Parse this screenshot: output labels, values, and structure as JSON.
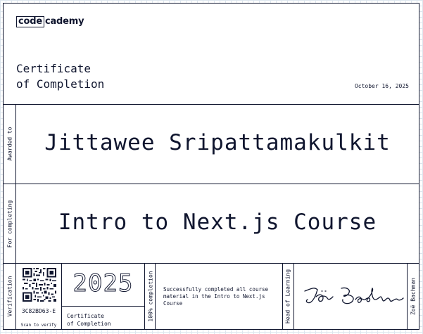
{
  "logo": {
    "part1": "code",
    "part2": "cademy"
  },
  "certificate": {
    "title": "Certificate\nof Completion",
    "date": "October 16, 2025",
    "awarded_label": "Awarded to",
    "recipient": "Jittawee Sripattamakulkit",
    "for_label": "For completing",
    "course": "Intro to Next.js Course"
  },
  "footer": {
    "verification_label": "Verification",
    "cert_id": "3C82BD63-E",
    "scan_text": "Scan to verify",
    "year": "2025",
    "cert_type": "Certificate\nof Completion",
    "completion_label": "100% completion",
    "description": "Successfully completed all course material in the Intro to Next.js Course",
    "signer_role": "Head of Learning",
    "signer_name": "Zoë Bachman",
    "signature_text": "Zoë Bachman"
  },
  "colors": {
    "ink": "#10162f",
    "grid": "#dde6ee"
  }
}
